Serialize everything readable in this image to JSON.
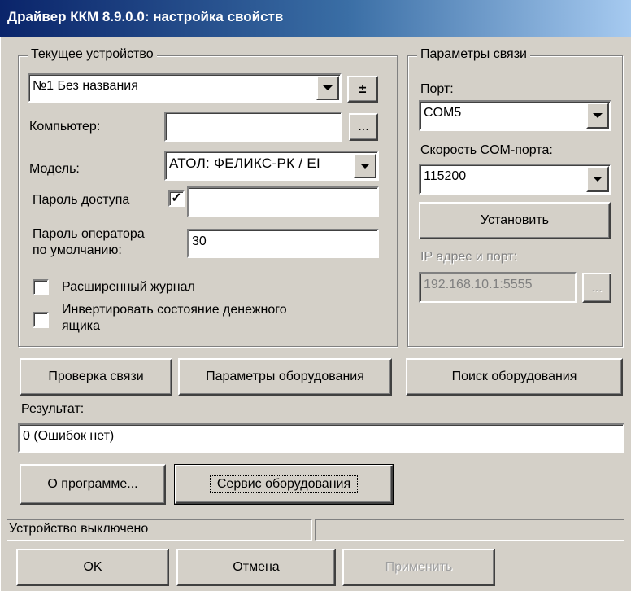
{
  "window": {
    "title": "Драйвер ККМ 8.9.0.0: настройка свойств"
  },
  "current_device": {
    "legend": "Текущее устройство",
    "device_select": "№1 Без названия",
    "plusminus_label": "±",
    "computer_label": "Компьютер:",
    "computer_value": "",
    "browse_label": "...",
    "model_label": "Модель:",
    "model_value": "АТОЛ: ФЕЛИКС-РК / EI",
    "access_password_label": "Пароль доступа",
    "access_password_checked": "✓",
    "access_password_value": "",
    "operator_password_label_line1": "Пароль оператора",
    "operator_password_label_line2": "по умолчанию:",
    "operator_password_value": "30",
    "extended_log_label": "Расширенный журнал",
    "invert_drawer_label_line1": "Инвертировать состояние денежного",
    "invert_drawer_label_line2": "ящика"
  },
  "connection": {
    "legend": "Параметры связи",
    "port_label": "Порт:",
    "port_value": "COM5",
    "speed_label": "Скорость COM-порта:",
    "speed_value": "115200",
    "install_button": "Установить",
    "ip_label": "IP адрес и порт:",
    "ip_value": "192.168.10.1:5555",
    "ip_browse_label": "..."
  },
  "actions": {
    "check_connection": "Проверка связи",
    "equipment_params": "Параметры оборудования",
    "search_equipment": "Поиск оборудования"
  },
  "result": {
    "label": "Результат:",
    "value": "0 (Ошибок нет)"
  },
  "secondary": {
    "about": "О программе...",
    "equipment_service": "Сервис оборудования"
  },
  "status": {
    "text": "Устройство выключено",
    "pane2": ""
  },
  "footer": {
    "ok": "OK",
    "cancel": "Отмена",
    "apply": "Применить"
  }
}
